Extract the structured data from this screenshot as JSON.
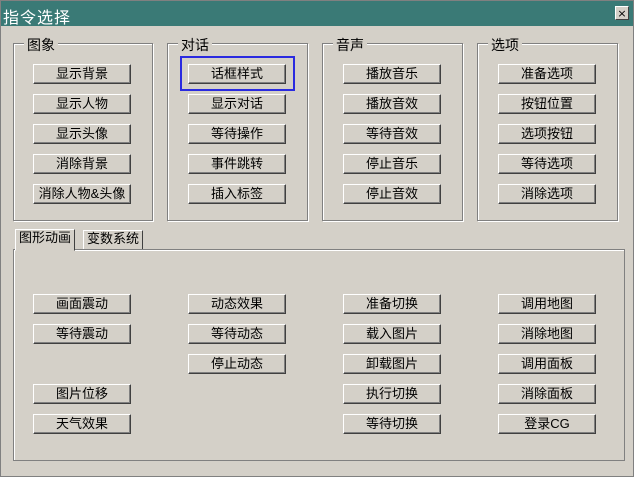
{
  "window": {
    "title": "指令选择",
    "close_label": "×"
  },
  "groups": [
    {
      "label": "图象",
      "buttons": [
        "显示背景",
        "显示人物",
        "显示头像",
        "消除背景",
        "消除人物&头像"
      ]
    },
    {
      "label": "对话",
      "buttons": [
        "话框样式",
        "显示对话",
        "等待操作",
        "事件跳转",
        "插入标签"
      ]
    },
    {
      "label": "音声",
      "buttons": [
        "播放音乐",
        "播放音效",
        "等待音效",
        "停止音乐",
        "停止音效"
      ]
    },
    {
      "label": "选项",
      "buttons": [
        "准备选项",
        "按钮位置",
        "选项按钮",
        "等待选项",
        "消除选项"
      ]
    }
  ],
  "tabs": [
    "图形动画",
    "变数系统"
  ],
  "active_tab": "图形动画",
  "focused_button": "话框样式",
  "panel": {
    "col1": [
      "画面震动",
      "等待震动",
      "图片位移",
      "天气效果"
    ],
    "col2": [
      "动态效果",
      "等待动态",
      "停止动态"
    ],
    "col3": [
      "准备切换",
      "载入图片",
      "卸载图片",
      "执行切换",
      "等待切换"
    ],
    "col4": [
      "调用地图",
      "消除地图",
      "调用面板",
      "消除面板",
      "登录CG"
    ]
  },
  "colors": {
    "titlebar": "#3a7a76",
    "focus_ring": "#2a2ae0",
    "face": "#d4d0c8"
  }
}
